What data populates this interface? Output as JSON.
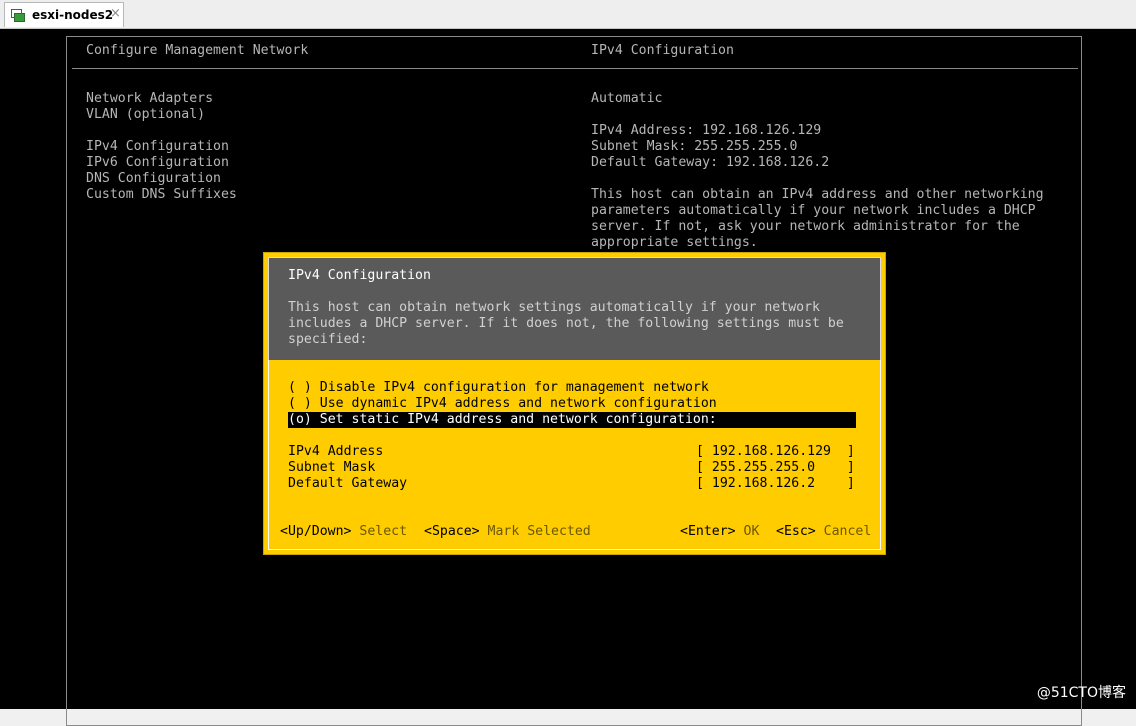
{
  "tab": {
    "title": "esxi-nodes2",
    "close": "×"
  },
  "left": {
    "header": "Configure Management Network",
    "menu": [
      "Network Adapters",
      "VLAN (optional)",
      "IPv4 Configuration",
      "IPv6 Configuration",
      "DNS Configuration",
      "Custom DNS Suffixes"
    ]
  },
  "right": {
    "header": "IPv4 Configuration",
    "mode": "Automatic",
    "ipv4_address": "IPv4 Address: 192.168.126.129",
    "subnet_mask": "Subnet Mask: 255.255.255.0",
    "default_gateway": "Default Gateway: 192.168.126.2",
    "desc": [
      "This host can obtain an IPv4 address and other networking",
      "parameters automatically if your network includes a DHCP",
      "server. If not, ask your network administrator for the",
      "appropriate settings."
    ]
  },
  "dialog": {
    "title": "IPv4 Configuration",
    "desc": [
      "This host can obtain network settings automatically if your network",
      "includes a DHCP server. If it does not, the following settings must be",
      "specified:"
    ],
    "options": [
      "( ) Disable IPv4 configuration for management network",
      "( ) Use dynamic IPv4 address and network configuration",
      "(o) Set static IPv4 address and network configuration:"
    ],
    "fields": [
      {
        "label": "IPv4 Address",
        "value": "[ 192.168.126.129  ]"
      },
      {
        "label": "Subnet Mask",
        "value": "[ 255.255.255.0    ]"
      },
      {
        "label": "Default Gateway",
        "value": "[ 192.168.126.2    ]"
      }
    ],
    "footer": {
      "updown_key": "<Up/Down>",
      "updown_label": "Select",
      "space_key": "<Space>",
      "space_label": "Mark Selected",
      "enter_key": "<Enter>",
      "enter_label": "OK",
      "esc_key": "<Esc>",
      "esc_label": "Cancel"
    }
  },
  "watermark": "@51CTO博客",
  "colors": {
    "accent": "#ffcc00",
    "background": "#000000",
    "dialog_header": "#5a5a5a"
  }
}
